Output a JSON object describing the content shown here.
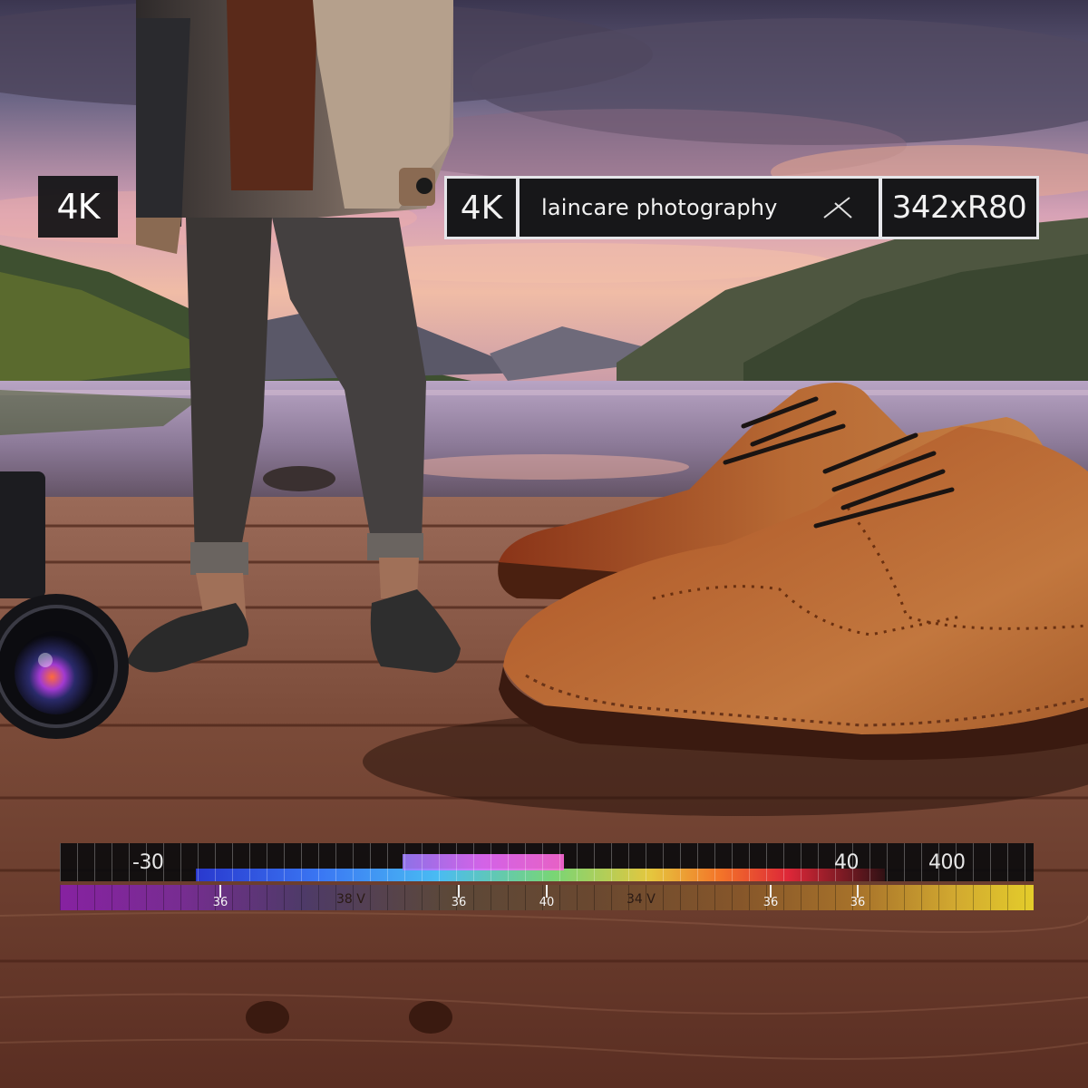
{
  "overlay": {
    "badge_left": "4K",
    "info_bar": {
      "quality": "4K",
      "title": "laincare photography",
      "close_icon": "close-icon",
      "resolution": "342xR80"
    }
  },
  "histogram": {
    "label_left": "-30",
    "label_mid": "40",
    "label_right": "400",
    "sub_label_1": "38 V",
    "sub_label_2": "34 V",
    "markers": [
      "36",
      "36",
      "40",
      "36",
      "36"
    ]
  },
  "colors": {
    "overlay_bg": "#141416",
    "overlay_text": "#ffffff",
    "shoe_leather": "#b36a35",
    "deck_wood": "#7a4630",
    "sky_pink": "#e8a8c0"
  }
}
